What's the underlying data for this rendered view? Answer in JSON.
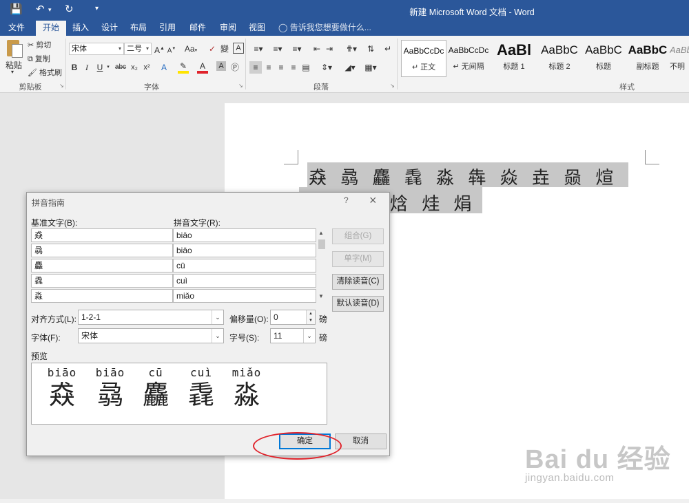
{
  "window": {
    "title": "新建 Microsoft Word 文档 - Word"
  },
  "qat": {
    "save_icon": "save-icon",
    "undo_icon": "undo-icon",
    "redo_icon": "redo-icon"
  },
  "tabs": [
    {
      "label": "文件"
    },
    {
      "label": "开始"
    },
    {
      "label": "插入"
    },
    {
      "label": "设计"
    },
    {
      "label": "布局"
    },
    {
      "label": "引用"
    },
    {
      "label": "邮件"
    },
    {
      "label": "审阅"
    },
    {
      "label": "视图"
    }
  ],
  "tellme": "告诉我您想要做什么...",
  "ribbon": {
    "clipboard": {
      "paste": "粘贴",
      "cut": "剪切",
      "copy": "复制",
      "format_painter": "格式刷",
      "label": "剪贴板"
    },
    "font": {
      "name": "宋体",
      "size": "二号",
      "label": "字体",
      "phonetic": "變",
      "aa": "Aa",
      "bold": "B",
      "italic": "I",
      "underline": "U",
      "strike": "abc",
      "sub": "x₂",
      "sup": "x²"
    },
    "paragraph": {
      "label": "段落"
    },
    "styles": {
      "label": "样式",
      "items": [
        {
          "preview": "AaBbCcDc",
          "name": "↵ 正文"
        },
        {
          "preview": "AaBbCcDc",
          "name": "↵ 无间隔"
        },
        {
          "preview": "AaBl",
          "name": "标题 1"
        },
        {
          "preview": "AaBbC",
          "name": "标题 2"
        },
        {
          "preview": "AaBbC",
          "name": "标题"
        },
        {
          "preview": "AaBbC",
          "name": "副标题"
        },
        {
          "preview": "AaBb",
          "name": "不明"
        }
      ]
    }
  },
  "document": {
    "line1": "猋 骉 麤 毳 淼 犇 焱 垚 赑 煊",
    "line2": "焓 烓 焆"
  },
  "dialog": {
    "title": "拼音指南",
    "help": "?",
    "close": "×",
    "base_label": "基准文字(B):",
    "ruby_label": "拼音文字(R):",
    "rows": [
      {
        "base": "猋",
        "ruby": "biāo"
      },
      {
        "base": "骉",
        "ruby": "biāo"
      },
      {
        "base": "麤",
        "ruby": "cū"
      },
      {
        "base": "毳",
        "ruby": "cuì"
      },
      {
        "base": "淼",
        "ruby": "miǎo"
      }
    ],
    "buttons": {
      "group": "组合(G)",
      "mono": "单字(M)",
      "clear": "清除读音(C)",
      "default": "默认读音(D)",
      "ok": "确定",
      "cancel": "取消"
    },
    "align_label": "对齐方式(L):",
    "align_value": "1-2-1",
    "offset_label": "偏移量(O):",
    "offset_value": "0",
    "offset_unit": "磅",
    "font_label": "字体(F):",
    "font_value": "宋体",
    "size_label": "字号(S):",
    "size_value": "11",
    "size_unit": "磅",
    "preview_label": "预览",
    "preview": [
      {
        "py": "biāo",
        "ch": "猋"
      },
      {
        "py": "biāo",
        "ch": "骉"
      },
      {
        "py": "cū",
        "ch": "麤"
      },
      {
        "py": "cuì",
        "ch": "毳"
      },
      {
        "py": "miǎo",
        "ch": "淼"
      }
    ]
  },
  "watermark": {
    "logo": "Bai du 经验",
    "url": "jingyan.baidu.com"
  },
  "colors": {
    "title_bar": "#2b579a",
    "highlight_circle": "#e0232b"
  }
}
